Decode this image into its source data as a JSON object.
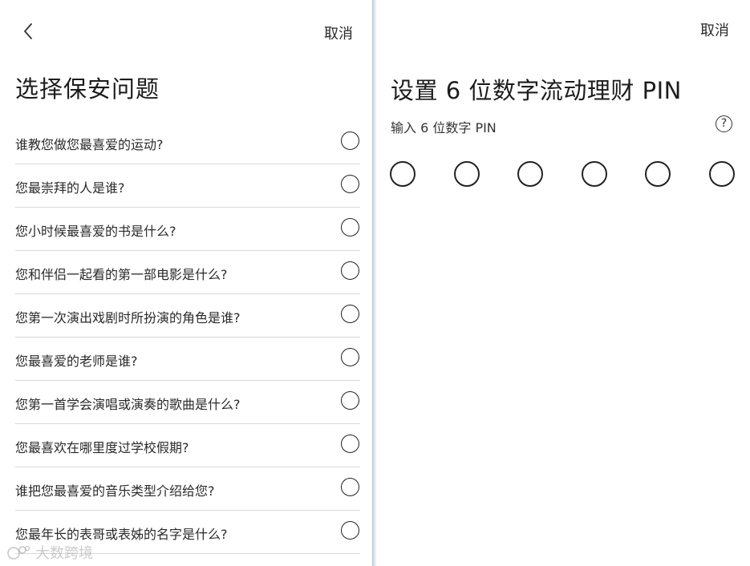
{
  "left_panel": {
    "cancel_label": "取消",
    "title": "选择保安问题",
    "questions": [
      "谁教您做您最喜爱的运动?",
      "您最崇拜的人是谁?",
      "您小时候最喜爱的书是什么?",
      "您和伴侣一起看的第一部电影是什么?",
      "您第一次演出戏剧时所扮演的角色是谁?",
      "您最喜爱的老师是谁?",
      "您第一首学会演唱或演奏的歌曲是什么?",
      "您最喜欢在哪里度过学校假期?",
      "谁把您最喜爱的音乐类型介绍给您?",
      "您最年长的表哥或表姊的名字是什么?"
    ]
  },
  "right_panel": {
    "cancel_label": "取消",
    "title": "设置 6 位数字流动理财 PIN",
    "pin_label": "输入 6 位数字 PIN",
    "help_symbol": "?",
    "pin_length": 6
  },
  "watermark": {
    "text": "大数跨境"
  }
}
